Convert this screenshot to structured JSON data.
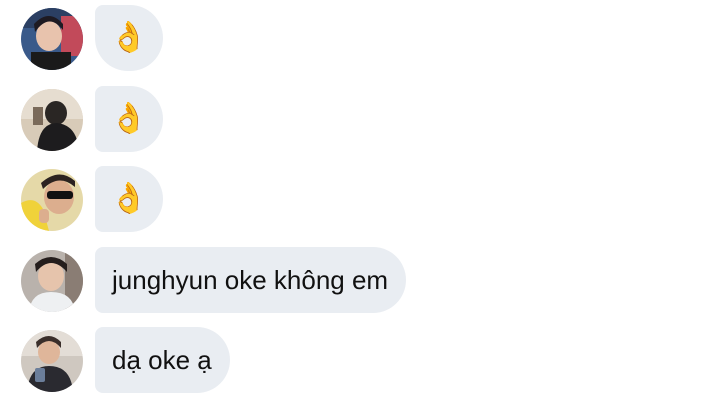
{
  "messages": [
    {
      "avatar": "avatar-1",
      "type": "emoji",
      "content": "👌",
      "icon": "ok-hand-emoji-icon"
    },
    {
      "avatar": "avatar-2",
      "type": "emoji",
      "content": "👌",
      "icon": "ok-hand-emoji-icon"
    },
    {
      "avatar": "avatar-3",
      "type": "emoji",
      "content": "👌",
      "icon": "ok-hand-emoji-icon"
    },
    {
      "avatar": "avatar-4",
      "type": "text",
      "content": "junghyun oke không em"
    },
    {
      "avatar": "avatar-5",
      "type": "text",
      "content": "dạ oke ạ"
    }
  ],
  "colors": {
    "bubble_background": "#e9edf2",
    "text": "#111111",
    "page_background": "#ffffff"
  }
}
